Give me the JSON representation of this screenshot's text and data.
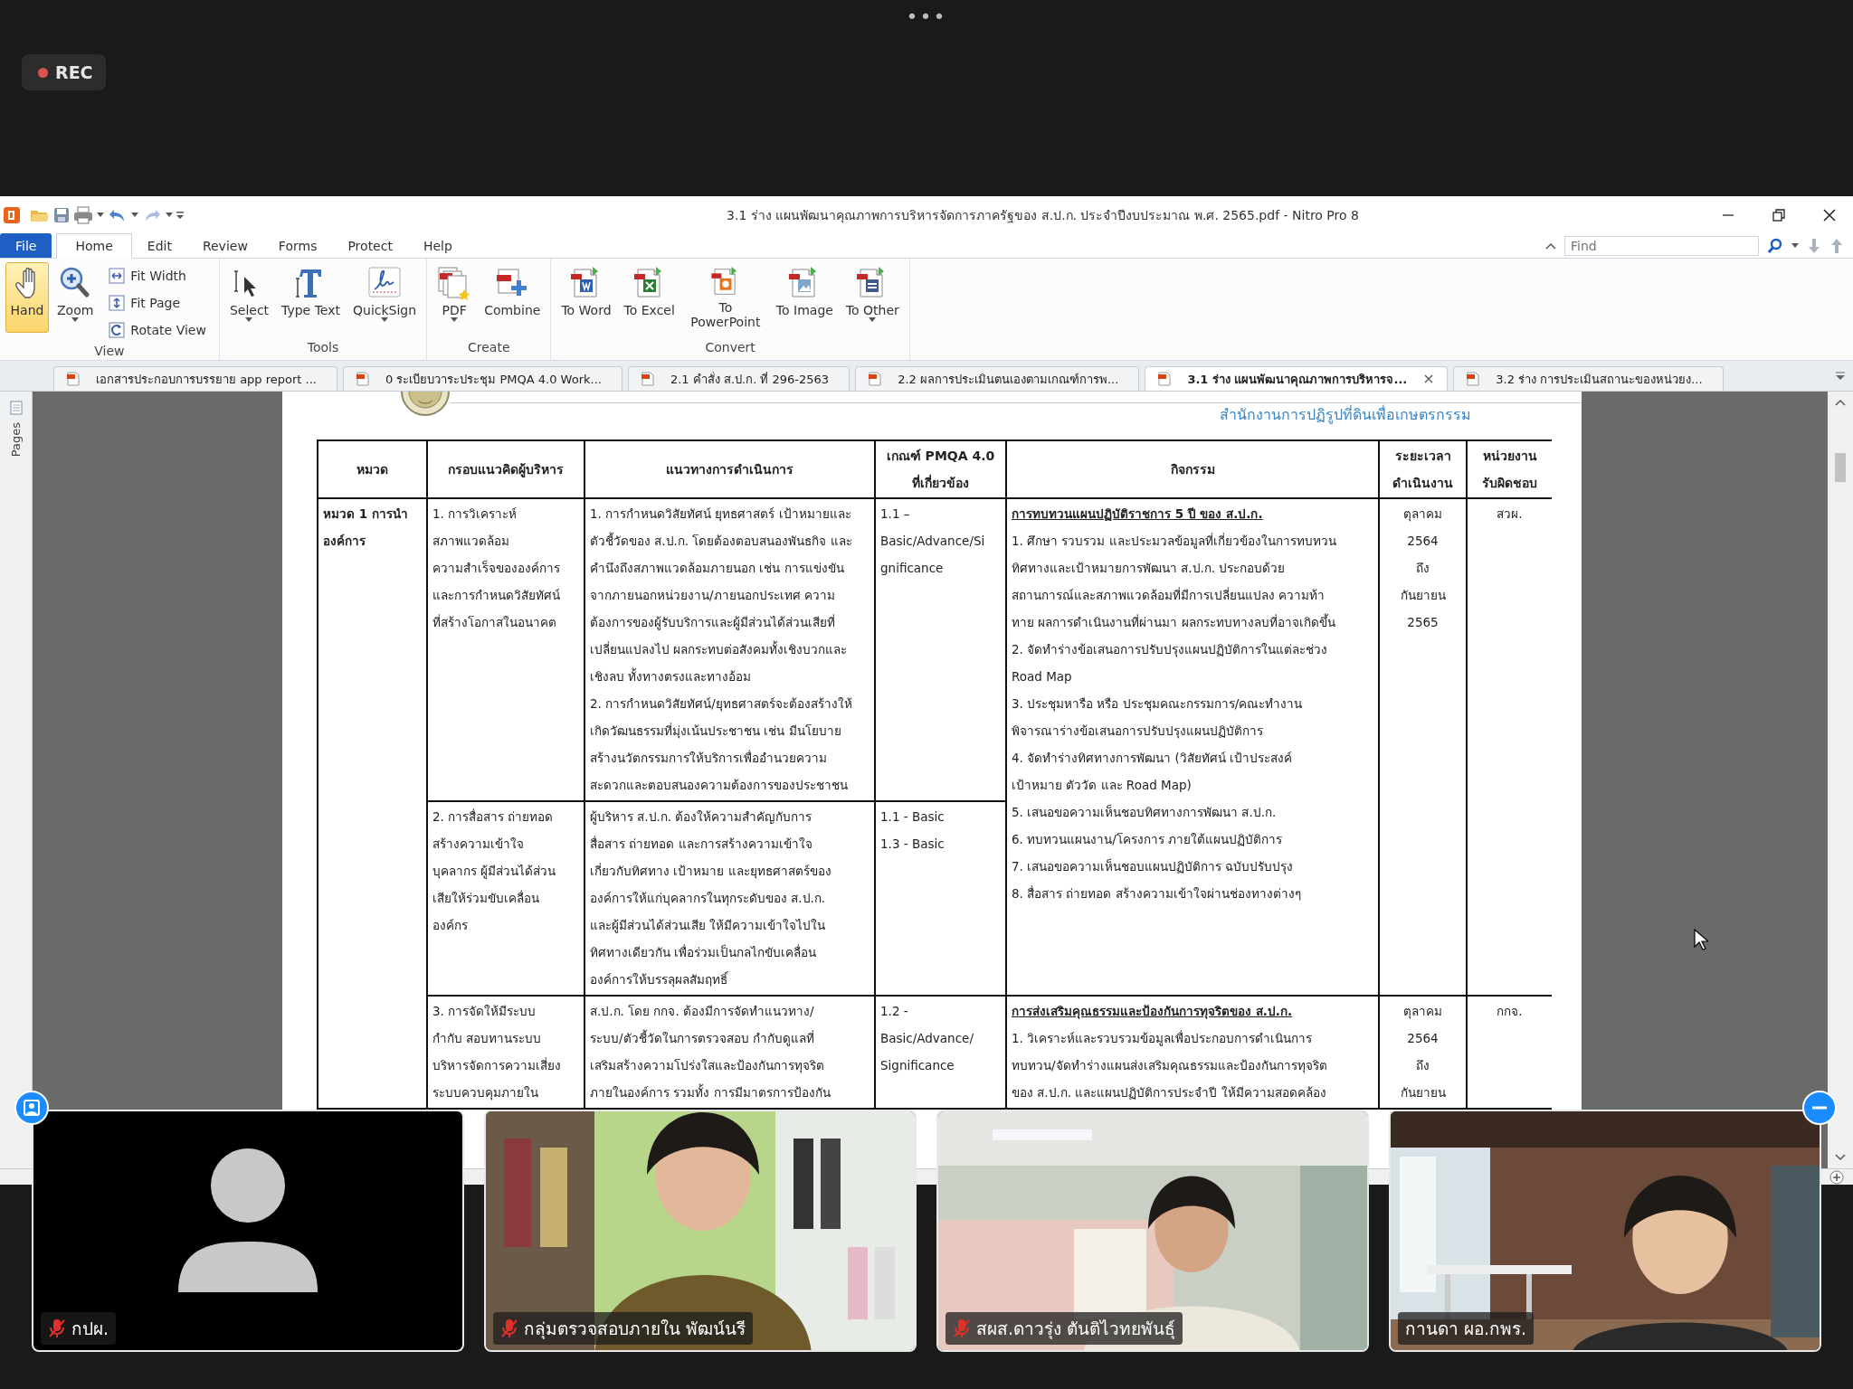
{
  "meeting_bar": {
    "more_label": "•••",
    "recording_label": "REC"
  },
  "window": {
    "title": "3.1 ร่าง แผนพัฒนาคุณภาพการบริหารจัดการภาครัฐของ ส.ป.ก. ประจำปีงบประมาณ พ.ศ. 2565.pdf - Nitro Pro 8"
  },
  "menu_tabs": [
    {
      "label": "File",
      "selected": false,
      "kind": "file"
    },
    {
      "label": "Home",
      "selected": true,
      "kind": "tab"
    },
    {
      "label": "Edit",
      "selected": false,
      "kind": "tab"
    },
    {
      "label": "Review",
      "selected": false,
      "kind": "tab"
    },
    {
      "label": "Forms",
      "selected": false,
      "kind": "tab"
    },
    {
      "label": "Protect",
      "selected": false,
      "kind": "tab"
    },
    {
      "label": "Help",
      "selected": false,
      "kind": "tab"
    }
  ],
  "find": {
    "placeholder": "Find"
  },
  "ribbon": [
    {
      "label": "View",
      "buttons": [
        {
          "label": "Hand",
          "kind": "large",
          "selected": true,
          "dropdown": false
        },
        {
          "label": "Zoom",
          "kind": "large",
          "selected": false,
          "dropdown": true
        },
        {
          "label": "Fit Width",
          "kind": "small",
          "selected": false,
          "dropdown": false
        },
        {
          "label": "Fit Page",
          "kind": "small",
          "selected": false,
          "dropdown": false
        },
        {
          "label": "Rotate View",
          "kind": "small",
          "selected": false,
          "dropdown": false
        }
      ]
    },
    {
      "label": "Tools",
      "buttons": [
        {
          "label": "Select",
          "kind": "large",
          "selected": false,
          "dropdown": true
        },
        {
          "label": "Type Text",
          "kind": "large",
          "selected": false,
          "dropdown": false
        },
        {
          "label": "QuickSign",
          "kind": "large",
          "selected": false,
          "dropdown": true
        }
      ]
    },
    {
      "label": "Create",
      "buttons": [
        {
          "label": "PDF",
          "kind": "large",
          "selected": false,
          "dropdown": true
        },
        {
          "label": "Combine",
          "kind": "large",
          "selected": false,
          "dropdown": false
        }
      ]
    },
    {
      "label": "Convert",
      "buttons": [
        {
          "label": "To Word",
          "kind": "large",
          "selected": false,
          "dropdown": false
        },
        {
          "label": "To Excel",
          "kind": "large",
          "selected": false,
          "dropdown": false
        },
        {
          "label": "To PowerPoint",
          "kind": "large",
          "selected": false,
          "dropdown": false
        },
        {
          "label": "To Image",
          "kind": "large",
          "selected": false,
          "dropdown": false
        },
        {
          "label": "To Other",
          "kind": "large",
          "selected": false,
          "dropdown": true
        }
      ]
    }
  ],
  "document_tabs": [
    {
      "label": "เอกสารประกอบการบรรยาย app report ...",
      "selected": false
    },
    {
      "label": "0 ระเบียบวาระประชุม PMQA 4.0 Work...",
      "selected": false
    },
    {
      "label": "2.1 คำสั่ง ส.ป.ก. ที่ 296-2563",
      "selected": false
    },
    {
      "label": "2.2 ผลการประเมินตนเองตามเกณฑ์การพ...",
      "selected": false
    },
    {
      "label": "3.1 ร่าง แผนพัฒนาคุณภาพการบริหารจ...",
      "selected": true
    },
    {
      "label": "3.2 ร่าง การประเมินสถานะของหน่วยง...",
      "selected": false
    }
  ],
  "side_panel": {
    "label": "Pages"
  },
  "page": {
    "organization": "สำนักงานการปฏิรูปที่ดินเพื่อเกษตรกรรม",
    "table": {
      "columns": [
        "หมวด",
        "กรอบแนวคิดผู้บริหาร",
        "แนวทางการดำเนินการ",
        "เกณฑ์ PMQA 4.0\nที่เกี่ยวข้อง",
        "กิจกรรม",
        "ระยะเวลา\nดำเนินงาน",
        "หน่วยงาน\nรับผิดชอบ"
      ],
      "category": "หมวด 1 การนำ\nองค์การ",
      "blocks": [
        {
          "rows": [
            {
              "concept": "1. การวิเคราะห์\nสภาพแวดล้อม\nความสำเร็จขององค์การ\nและการกำหนดวิสัยทัศน์\nที่สร้างโอกาสในอนาคต",
              "approach": [
                "1. การกำหนดวิสัยทัศน์ ยุทธศาสตร์ เป้าหมายและ\nตัวชี้วัดของ ส.ป.ก. โดยต้องตอบสนองพันธกิจ และ\nคำนึงถึงสภาพแวดล้อมภายนอก เช่น การแข่งขัน\nจากภายนอกหน่วยงาน/ภายนอกประเทศ ความ\nต้องการของผู้รับบริการและผู้มีส่วนได้ส่วนเสียที่\nเปลี่ยนแปลงไป ผลกระทบต่อสังคมทั้งเชิงบวกและ\nเชิงลบ ทั้งทางตรงและทางอ้อม",
                "2. การกำหนดวิสัยทัศน์/ยุทธศาสตร์จะต้องสร้างให้\nเกิดวัฒนธรรมที่มุ่งเน้นประชาชน เช่น มีนโยบาย\nสร้างนวัตกรรมการให้บริการเพื่ออำนวยความ\nสะดวกและตอบสนองความต้องการของประชาชน"
              ],
              "criteria": "1.1 –\nBasic/Advance/Si\ngnificance"
            },
            {
              "concept": "2. การสื่อสาร ถ่ายทอด\nสร้างความเข้าใจ\nบุคลากร ผู้มีส่วนได้ส่วน\nเสียให้ร่วมขับเคลื่อน\nองค์กร",
              "approach": [
                "ผู้บริหาร ส.ป.ก. ต้องให้ความสำคัญกับการ\nสื่อสาร ถ่ายทอด และการสร้างความเข้าใจ\nเกี่ยวกับทิศทาง เป้าหมาย และยุทธศาสตร์ของ\nองค์การให้แก่บุคลากรในทุกระดับของ ส.ป.ก.\nและผู้มีส่วนได้ส่วนเสีย ให้มีความเข้าใจไปใน\nทิศทางเดียวกัน เพื่อร่วมเป็นกลไกขับเคลื่อน\nองค์การให้บรรลุผลสัมฤทธิ์"
              ],
              "criteria": "1.1 - Basic\n1.3 - Basic"
            }
          ],
          "activity_heading": "การทบทวนแผนปฏิบัติราชการ 5 ปี ของ ส.ป.ก.",
          "activities": [
            "1. ศึกษา รวบรวม และประมวลข้อมูลที่เกี่ยวข้องในการทบทวน\nทิศทางและเป้าหมายการพัฒนา ส.ป.ก. ประกอบด้วย\nสถานการณ์และสภาพแวดล้อมที่มีการเปลี่ยนแปลง ความท้า\nทาย ผลการดำเนินงานที่ผ่านมา ผลกระทบทางลบที่อาจเกิดขึ้น",
            "2. จัดทำร่างข้อเสนอการปรับปรุงแผนปฏิบัติการในแต่ละช่วง\nRoad Map",
            "3. ประชุมหารือ หรือ ประชุมคณะกรรมการ/คณะทำงาน\nพิจารณาร่างข้อเสนอการปรับปรุงแผนปฏิบัติการ",
            "4. จัดทำร่างทิศทางการพัฒนา (วิสัยทัศน์ เป้าประสงค์\nเป้าหมาย ตัววัด และ Road Map)",
            "5. เสนอขอความเห็นชอบทิศทางการพัฒนา ส.ป.ก.",
            "6. ทบทวนแผนงาน/โครงการ ภายใต้แผนปฏิบัติการ",
            "7. เสนอขอความเห็นชอบแผนปฏิบัติการ ฉบับปรับปรุง",
            "8. สื่อสาร ถ่ายทอด สร้างความเข้าใจผ่านช่องทางต่างๆ"
          ],
          "period": "ตุลาคม\n2564\nถึง\nกันยายน\n2565",
          "unit": "สวผ."
        },
        {
          "rows": [
            {
              "concept": "3. การจัดให้มีระบบ\nกำกับ สอบทานระบบ\nบริหารจัดการความเสี่ยง\nระบบควบคุมภายใน",
              "approach": [
                "ส.ป.ก. โดย กกจ. ต้องมีการจัดทำแนวทาง/\nระบบ/ตัวชี้วัดในการตรวจสอบ กำกับดูแลที่\nเสริมสร้างความโปร่งใสและป้องกันการทุจริต\nภายในองค์การ รวมทั้ง การมีมาตรการป้องกัน"
              ],
              "criteria": "1.2 -\nBasic/Advance/\nSignificance"
            }
          ],
          "activity_heading": "การส่งเสริมคุณธรรมและป้องกันการทุจริตของ ส.ป.ก.",
          "activities": [
            "1. วิเคราะห์และรวบรวมข้อมูลเพื่อประกอบการดำเนินการ\nทบทวน/จัดทำร่างแผนส่งเสริมคุณธรรมและป้องกันการทุจริต\nของ ส.ป.ก. และแผนปฏิบัติการประจำปี ให้มีความสอดคล้อง"
          ],
          "period": "ตุลาคม\n2564\nถึง\nกันยายน",
          "unit": "กกจ."
        }
      ]
    }
  },
  "participants": [
    {
      "name": "กปผ.",
      "muted": true,
      "video": false
    },
    {
      "name": "กลุ่มตรวจสอบภายใน พัฒน์นรี",
      "muted": true,
      "video": true
    },
    {
      "name": "สผส.ดาวรุ่ง ตันติไวทยพันธุ์",
      "muted": true,
      "video": true
    },
    {
      "name": "กานดา ผอ.กพร.",
      "muted": false,
      "video": true
    }
  ]
}
